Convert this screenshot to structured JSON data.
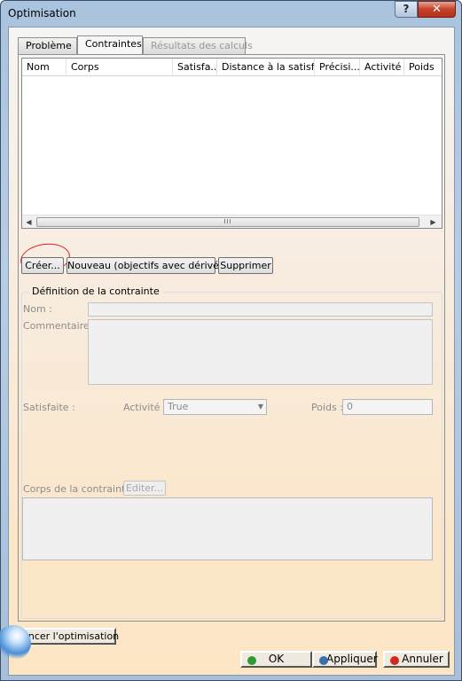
{
  "window": {
    "title": "Optimisation",
    "help_label": "?",
    "close_label": "✕"
  },
  "tabs": [
    {
      "label": "Problème",
      "state": "normal"
    },
    {
      "label": "Contraintes",
      "state": "active"
    },
    {
      "label": "Résultats des calculs",
      "state": "disabled"
    }
  ],
  "table": {
    "columns": [
      "Nom",
      "Corps",
      "Satisfa...",
      "Distance à la satisf...",
      "Précisi...",
      "Activité",
      "Poids"
    ],
    "rows": [],
    "scroll_thumb": "III"
  },
  "actions": {
    "create": "Créer...",
    "new_derivatives": "Nouveau (objectifs avec dérivées)",
    "delete": "Supprimer"
  },
  "definition": {
    "group_title": "Définition de la contrainte",
    "name_label": "Nom :",
    "comment_label": "Commentaire :",
    "satisfied_label": "Satisfaite :",
    "activity_label": "Activité :",
    "activity_value": "True",
    "weight_label": "Poids :",
    "weight_value": "0",
    "body_label": "Corps de la contrainte :",
    "edit_button": "Editer..."
  },
  "footer": {
    "run_optimisation": "Lancer l'optimisation",
    "ok": "OK",
    "apply": "Appliquer",
    "cancel": "Annuler"
  },
  "colors": {
    "ok_dot": "#2e9b2e",
    "apply_dot": "#3a6fb0",
    "cancel_dot": "#d22a1e",
    "annotation": "#e31d1d"
  }
}
